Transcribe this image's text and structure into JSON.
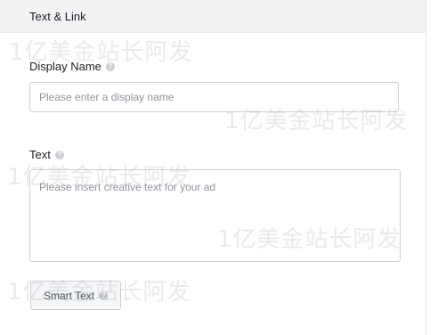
{
  "header": {
    "title": "Text & Link"
  },
  "display_name": {
    "label": "Display Name",
    "placeholder": "Please enter a display name",
    "value": ""
  },
  "text_field": {
    "label": "Text",
    "placeholder": "Please insert creative text for your ad",
    "value": ""
  },
  "smart_text_button": {
    "label": "Smart Text"
  },
  "icons": {
    "info": "info-icon",
    "info_glyph": "?"
  },
  "watermark": {
    "text": "1亿美金站长阿发"
  },
  "colors": {
    "header_bg": "#f2f3f5",
    "input_border": "#ccd0d5",
    "placeholder": "#90949c"
  }
}
